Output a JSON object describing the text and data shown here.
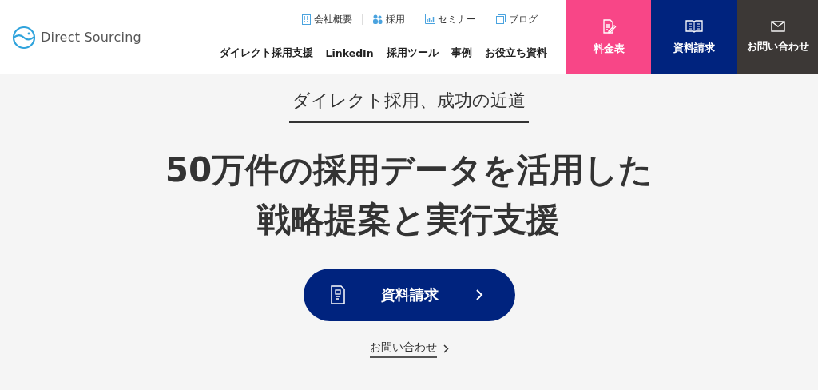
{
  "header": {
    "logo": "Direct Sourcing",
    "top_links": [
      {
        "label": "会社概要"
      },
      {
        "label": "採用"
      },
      {
        "label": "セミナー"
      },
      {
        "label": "ブログ"
      }
    ],
    "nav": [
      {
        "label": "ダイレクト採用支援"
      },
      {
        "label": "LinkedIn"
      },
      {
        "label": "採用ツール"
      },
      {
        "label": "事例"
      },
      {
        "label": "お役立ち資料"
      }
    ],
    "cta": [
      {
        "label": "料金表",
        "color": "#f84687"
      },
      {
        "label": "資料請求",
        "color": "#00237e"
      },
      {
        "label": "お問い合わせ",
        "color": "#3c3836"
      }
    ]
  },
  "hero": {
    "tagline": "ダイレクト採用、成功の近道",
    "headline": [
      "50万件の採用データを活用した",
      "戦略提案と実行支援"
    ],
    "button": "資料請求",
    "link": "お問い合わせ"
  }
}
